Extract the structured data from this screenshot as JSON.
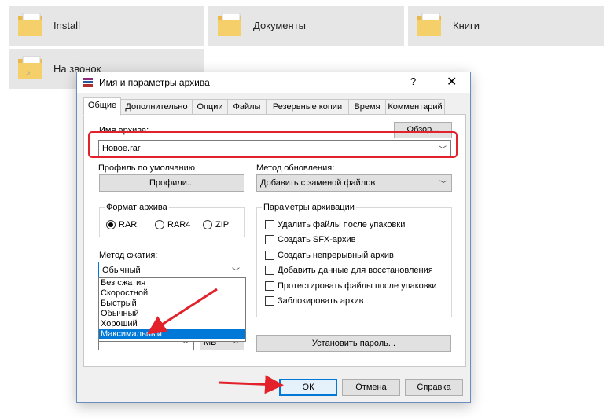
{
  "folders": [
    {
      "label": "Install"
    },
    {
      "label": "Документы"
    },
    {
      "label": "Книги"
    },
    {
      "label": "На звонок"
    }
  ],
  "dialog": {
    "title": "Имя и параметры архива",
    "help": "?",
    "close": "✕",
    "tabs": [
      "Общие",
      "Дополнительно",
      "Опции",
      "Файлы",
      "Резервные копии",
      "Время",
      "Комментарий"
    ],
    "archive_name_label": "Имя архива:",
    "archive_name_value": "Новое.rar",
    "browse_button": "Обзор...",
    "profile_label": "Профиль по умолчанию",
    "profiles_button": "Профили...",
    "update_method_label": "Метод обновления:",
    "update_method_value": "Добавить с заменой файлов",
    "format_group_title": "Формат архива",
    "formats": [
      "RAR",
      "RAR4",
      "ZIP"
    ],
    "format_selected": "RAR",
    "compression_label": "Метод сжатия:",
    "compression_value": "Обычный",
    "compression_options": [
      "Без сжатия",
      "Скоростной",
      "Быстрый",
      "Обычный",
      "Хороший",
      "Максимальный"
    ],
    "compression_highlighted": "Максимальный",
    "unit_value": "МБ",
    "options_group_title": "Параметры архивации",
    "options": [
      "Удалить файлы после упаковки",
      "Создать SFX-архив",
      "Создать непрерывный архив",
      "Добавить данные для восстановления",
      "Протестировать файлы после упаковки",
      "Заблокировать архив"
    ],
    "set_password_button": "Установить пароль...",
    "ok_button": "ОК",
    "cancel_button": "Отмена",
    "help_button": "Справка"
  },
  "colors": {
    "highlight": "#0078d7",
    "annotation": "#e2212b",
    "folder": "#f5cf6a"
  }
}
